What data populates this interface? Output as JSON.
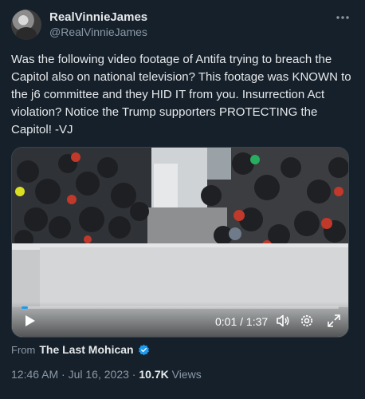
{
  "author": {
    "display_name": "RealVinnieJames",
    "handle": "@RealVinnieJames"
  },
  "more_icon": "more-horizontal-icon",
  "tweet": {
    "text": "Was the following video footage of Antifa trying to breach the Capitol also on national television? This footage was KNOWN to the j6 committee and they HID IT from you. Insurrection Act violation? Notice the Trump supporters PROTECTING the Capitol! -VJ"
  },
  "video": {
    "time": "0:01 / 1:37",
    "progress": 0.01,
    "icons": [
      "play-icon",
      "volume-icon",
      "settings-gear-icon",
      "fullscreen-icon"
    ],
    "accent": "#1d9bf0"
  },
  "from": {
    "prefix": "From",
    "author": "The Last Mohican",
    "verified_color": "#1d9bf0"
  },
  "meta": {
    "time": "12:46 AM",
    "separator1": " · ",
    "date": "Jul 16, 2023",
    "separator2": " · ",
    "views": "10.7K",
    "views_label": " Views"
  }
}
